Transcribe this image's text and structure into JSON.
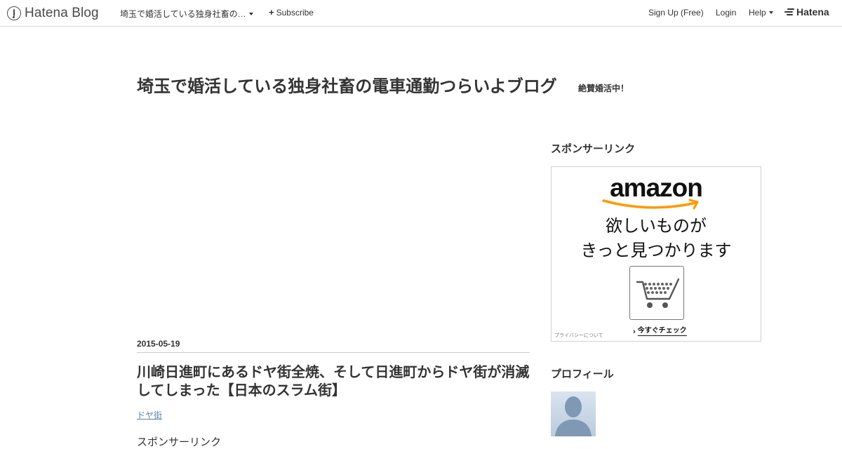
{
  "global_header": {
    "brand": "Hatena Blog",
    "blog_menu_label": "埼玉で婚活している独身社畜の…",
    "subscribe_label": "Subscribe",
    "signup_label": "Sign Up (Free)",
    "login_label": "Login",
    "help_label": "Help",
    "hatena_label": "Hatena"
  },
  "blog": {
    "title": "埼玉で婚活している独身社畜の電車通勤つらいよブログ",
    "description": "絶賛婚活中！"
  },
  "entry": {
    "date": "2015-05-19",
    "title": "川崎日進町にあるドヤ街全焼、そして日進町からドヤ街が消滅してしまった【日本のスラム街】",
    "category": "ドヤ街",
    "sponsor_label": "スポンサーリンク"
  },
  "sidebar": {
    "sponsor_heading": "スポンサーリンク",
    "ad": {
      "logo": "amazon",
      "line1": "欲しいものが",
      "line2": "きっと見つかります",
      "privacy": "プライバシーについて",
      "cta": "今すぐチェック",
      "accent_color": "#ff9900"
    },
    "profile_heading": "プロフィール"
  },
  "icons": {
    "brand": "pen-nib-circle-icon",
    "blog_menu": "caret-down-icon",
    "subscribe": "plus-icon",
    "help": "caret-down-icon",
    "hatena": "hatena-stripes-icon",
    "ad_cart": "shopping-cart-icon",
    "ad_cta": "chevron-right-icon",
    "avatar": "person-silhouette-icon"
  }
}
